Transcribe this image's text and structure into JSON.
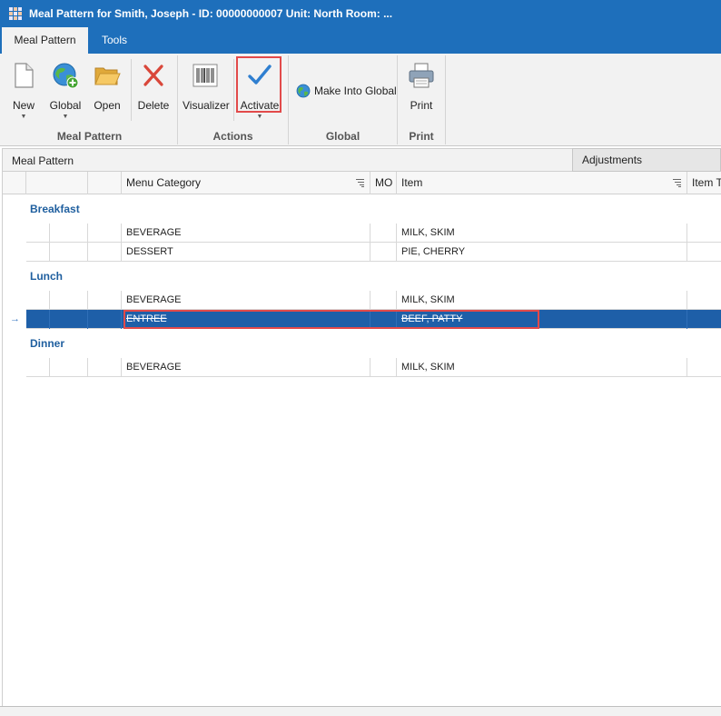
{
  "window": {
    "title": "Meal Pattern for Smith, Joseph - ID: 00000000007 Unit: North Room: ..."
  },
  "ribbon_tabs": [
    {
      "label": "Meal Pattern",
      "active": true
    },
    {
      "label": "Tools",
      "active": false
    }
  ],
  "ribbon": {
    "groups": {
      "meal_pattern": "Meal Pattern",
      "actions": "Actions",
      "global": "Global",
      "print": "Print"
    },
    "buttons": {
      "new": "New",
      "global": "Global",
      "open": "Open",
      "delete": "Delete",
      "visualizer": "Visualizer",
      "activate": "Activate",
      "make_into_global": "Make Into Global",
      "print": "Print"
    }
  },
  "panel": {
    "title": "Meal Pattern",
    "adjustments_tab": "Adjustments"
  },
  "grid": {
    "columns": {
      "menu_category": "Menu Category",
      "mo": "MO",
      "item": "Item",
      "item_type": "Item T"
    },
    "groups": [
      {
        "name": "Breakfast",
        "rows": [
          {
            "category": "BEVERAGE",
            "item": "MILK, SKIM"
          },
          {
            "category": "DESSERT",
            "item": "PIE, CHERRY"
          }
        ]
      },
      {
        "name": "Lunch",
        "rows": [
          {
            "category": "BEVERAGE",
            "item": "MILK, SKIM"
          },
          {
            "category": "ENTREE",
            "item": "BEEF, PATTY"
          }
        ]
      },
      {
        "name": "Dinner",
        "rows": [
          {
            "category": "BEVERAGE",
            "item": "MILK, SKIM"
          }
        ]
      }
    ],
    "selected_row_indicator": "→"
  },
  "colors": {
    "titlebar": "#1e6fbb",
    "selection": "#1e5fa8",
    "highlight_border": "#e24a4a",
    "group_text": "#1f5f9f"
  }
}
